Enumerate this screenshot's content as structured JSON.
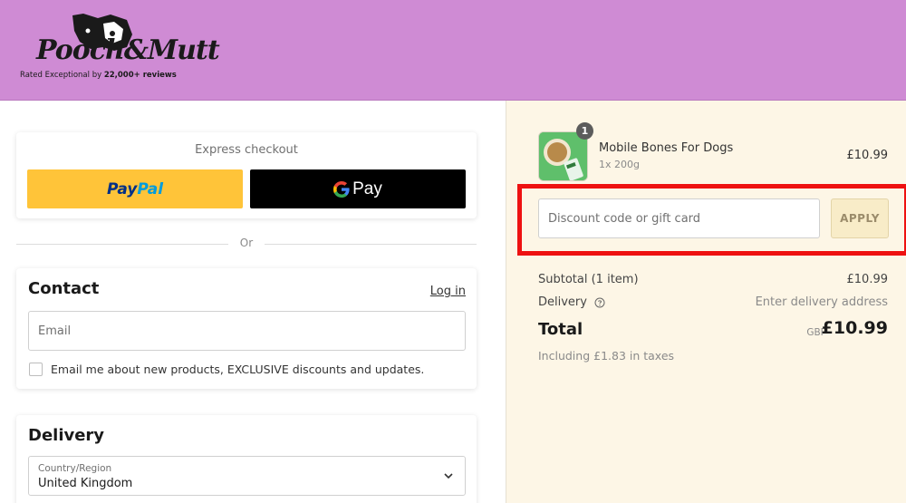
{
  "header": {
    "brand": "Pooch&Mutt",
    "tagline_prefix": "Rated Exceptional by",
    "tagline_bold": "22,000+ reviews",
    "bg_color": "#cf8bd4"
  },
  "express": {
    "title": "Express checkout",
    "paypal_pay": "Pay",
    "paypal_pal": "Pal",
    "gpay_label": "Pay"
  },
  "divider": {
    "text": "Or"
  },
  "contact": {
    "title": "Contact",
    "login_label": "Log in",
    "email_placeholder": "Email",
    "marketing_label": "Email me about new products, EXCLUSIVE discounts and updates."
  },
  "delivery": {
    "title": "Delivery",
    "country_label": "Country/Region",
    "country_value": "United Kingdom"
  },
  "order": {
    "item": {
      "name": "Mobile Bones For Dogs",
      "variant": "1x 200g",
      "price": "£10.99",
      "quantity": "1"
    },
    "discount_placeholder": "Discount code or gift card",
    "apply_label": "APPLY",
    "subtotal_label": "Subtotal (1 item)",
    "subtotal_value": "£10.99",
    "delivery_label": "Delivery",
    "delivery_value": "Enter delivery address",
    "total_label": "Total",
    "total_currency": "GBP",
    "total_value": "£10.99",
    "taxes_note": "Including £1.83 in taxes"
  },
  "icons": [
    "dog-logo-icon",
    "google-g-icon",
    "help-circle-icon",
    "chevron-down-icon"
  ],
  "colors": {
    "highlight": "#ee1111",
    "paypal_yellow": "#ffc439",
    "sidebar_bg": "#fdf6e6"
  }
}
